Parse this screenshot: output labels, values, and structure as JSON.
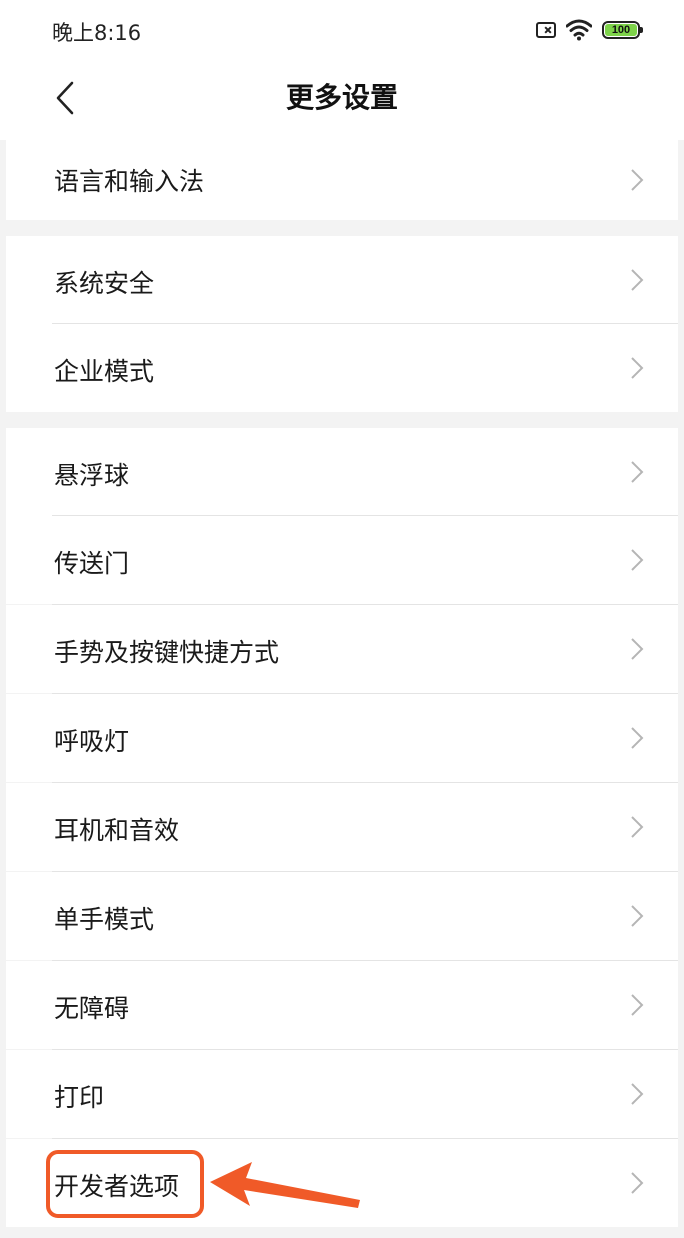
{
  "status_bar": {
    "time": "晚上8:16",
    "battery": "100"
  },
  "header": {
    "title": "更多设置"
  },
  "groups": [
    {
      "items": [
        "语言和输入法"
      ]
    },
    {
      "items": [
        "系统安全",
        "企业模式"
      ]
    },
    {
      "items": [
        "悬浮球",
        "传送门",
        "手势及按键快捷方式",
        "呼吸灯",
        "耳机和音效",
        "单手模式",
        "无障碍",
        "打印",
        "开发者选项"
      ]
    }
  ],
  "annotation": {
    "highlight_color": "#f05a28",
    "target": "开发者选项"
  },
  "icons": [
    "back-icon",
    "chevron-right-icon",
    "wifi-icon",
    "battery-icon",
    "no-sim-icon"
  ]
}
